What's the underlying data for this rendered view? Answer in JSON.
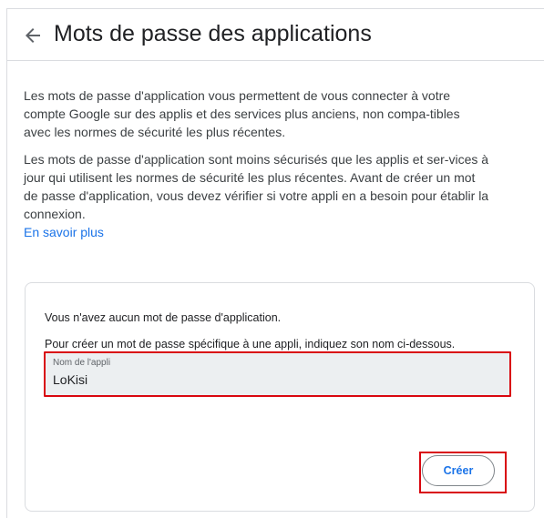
{
  "header": {
    "title": "Mots de passe des applications",
    "back_icon": "arrow-back-icon"
  },
  "intro": {
    "paragraph1": "Les mots de passe d'application vous permettent de vous connecter à votre compte Google sur des applis et des services plus anciens, non compa-tibles avec les normes de sécurité les plus récentes.",
    "paragraph2": "Les mots de passe d'application sont moins sécurisés que les applis et ser-vices à jour qui utilisent les normes de sécurité les plus récentes. Avant de créer un mot de passe d'application, vous devez vérifier si votre appli en a besoin pour établir la connexion.",
    "learn_more": "En savoir plus"
  },
  "card": {
    "empty_message": "Vous n'avez aucun mot de passe d'application.",
    "instructions": "Pour créer un mot de passe spécifique à une appli, indiquez son nom ci-dessous.",
    "app_name_label": "Nom de l'appli",
    "app_name_value": "LoKisi",
    "create_label": "Créer"
  },
  "colors": {
    "accent": "#1a73e8",
    "highlight": "#d9070f",
    "field_bg": "#eceff1"
  }
}
